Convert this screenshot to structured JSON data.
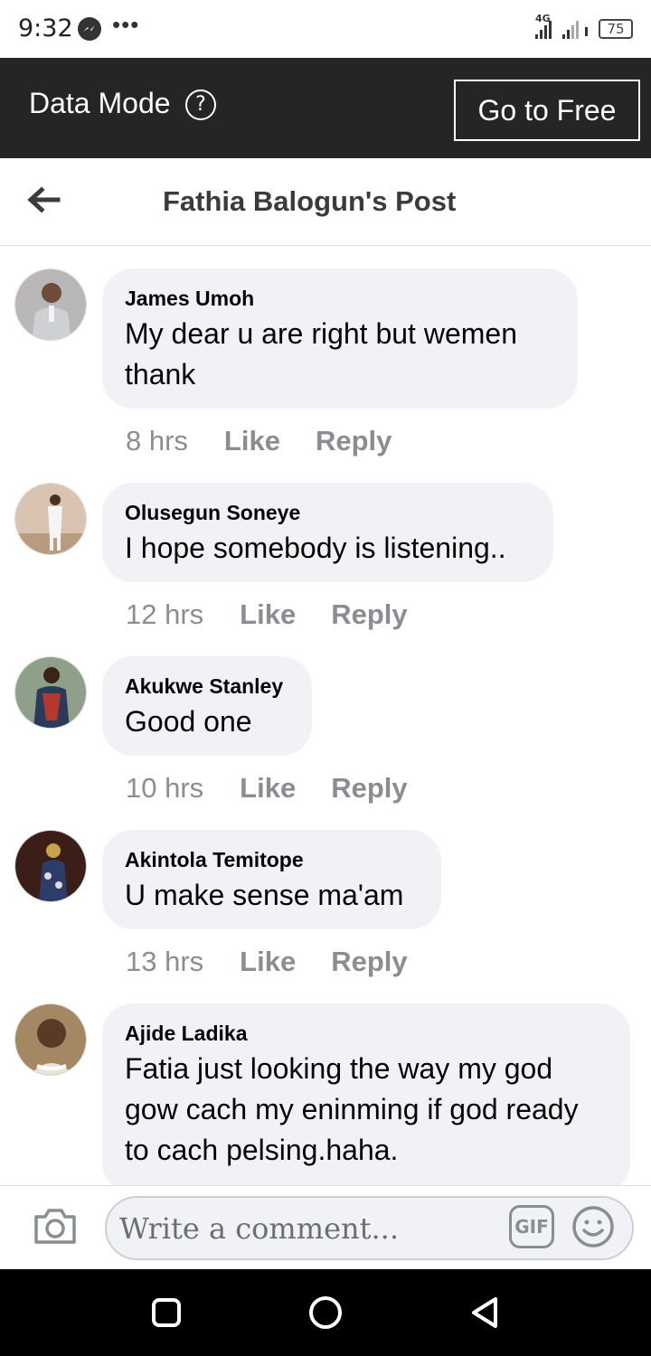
{
  "status_bar": {
    "time": "9:32",
    "network": "4G",
    "battery": "75"
  },
  "data_mode": {
    "label": "Data Mode",
    "help_icon": "question-circle-icon",
    "button_label": "Go to Free"
  },
  "header": {
    "title": "Fathia Balogun's Post",
    "back_icon": "arrow-left-icon"
  },
  "comments": [
    {
      "author": "James Umoh",
      "text": "My dear u are right but wemen thank",
      "time": "8 hrs",
      "like": "Like",
      "reply": "Reply",
      "avatar_color": "#a8a6a8"
    },
    {
      "author": "Olusegun Soneye",
      "text": "I hope somebody is listening..",
      "time": "12 hrs",
      "like": "Like",
      "reply": "Reply",
      "avatar_color": "#c9b3a0"
    },
    {
      "author": "Akukwe Stanley",
      "text": "Good one",
      "time": "10 hrs",
      "like": "Like",
      "reply": "Reply",
      "avatar_color": "#5f6c5a"
    },
    {
      "author": "Akintola Temitope",
      "text": "U make sense ma'am",
      "time": "13 hrs",
      "like": "Like",
      "reply": "Reply",
      "avatar_color": "#4a2a22"
    },
    {
      "author": "Ajide Ladika",
      "text": "Fatia just looking the way my god gow cach my eninming if god ready to cach pelsing.haha.",
      "avatar_color": "#9d7e56"
    }
  ],
  "composer": {
    "placeholder": "Write a comment...",
    "gif_label": "GIF",
    "camera_icon": "camera-icon",
    "emoji_icon": "smiley-icon"
  },
  "colors": {
    "data_bar_bg": "#242526",
    "bubble_bg": "#f0f2f5",
    "meta_text": "#8a8d91"
  }
}
